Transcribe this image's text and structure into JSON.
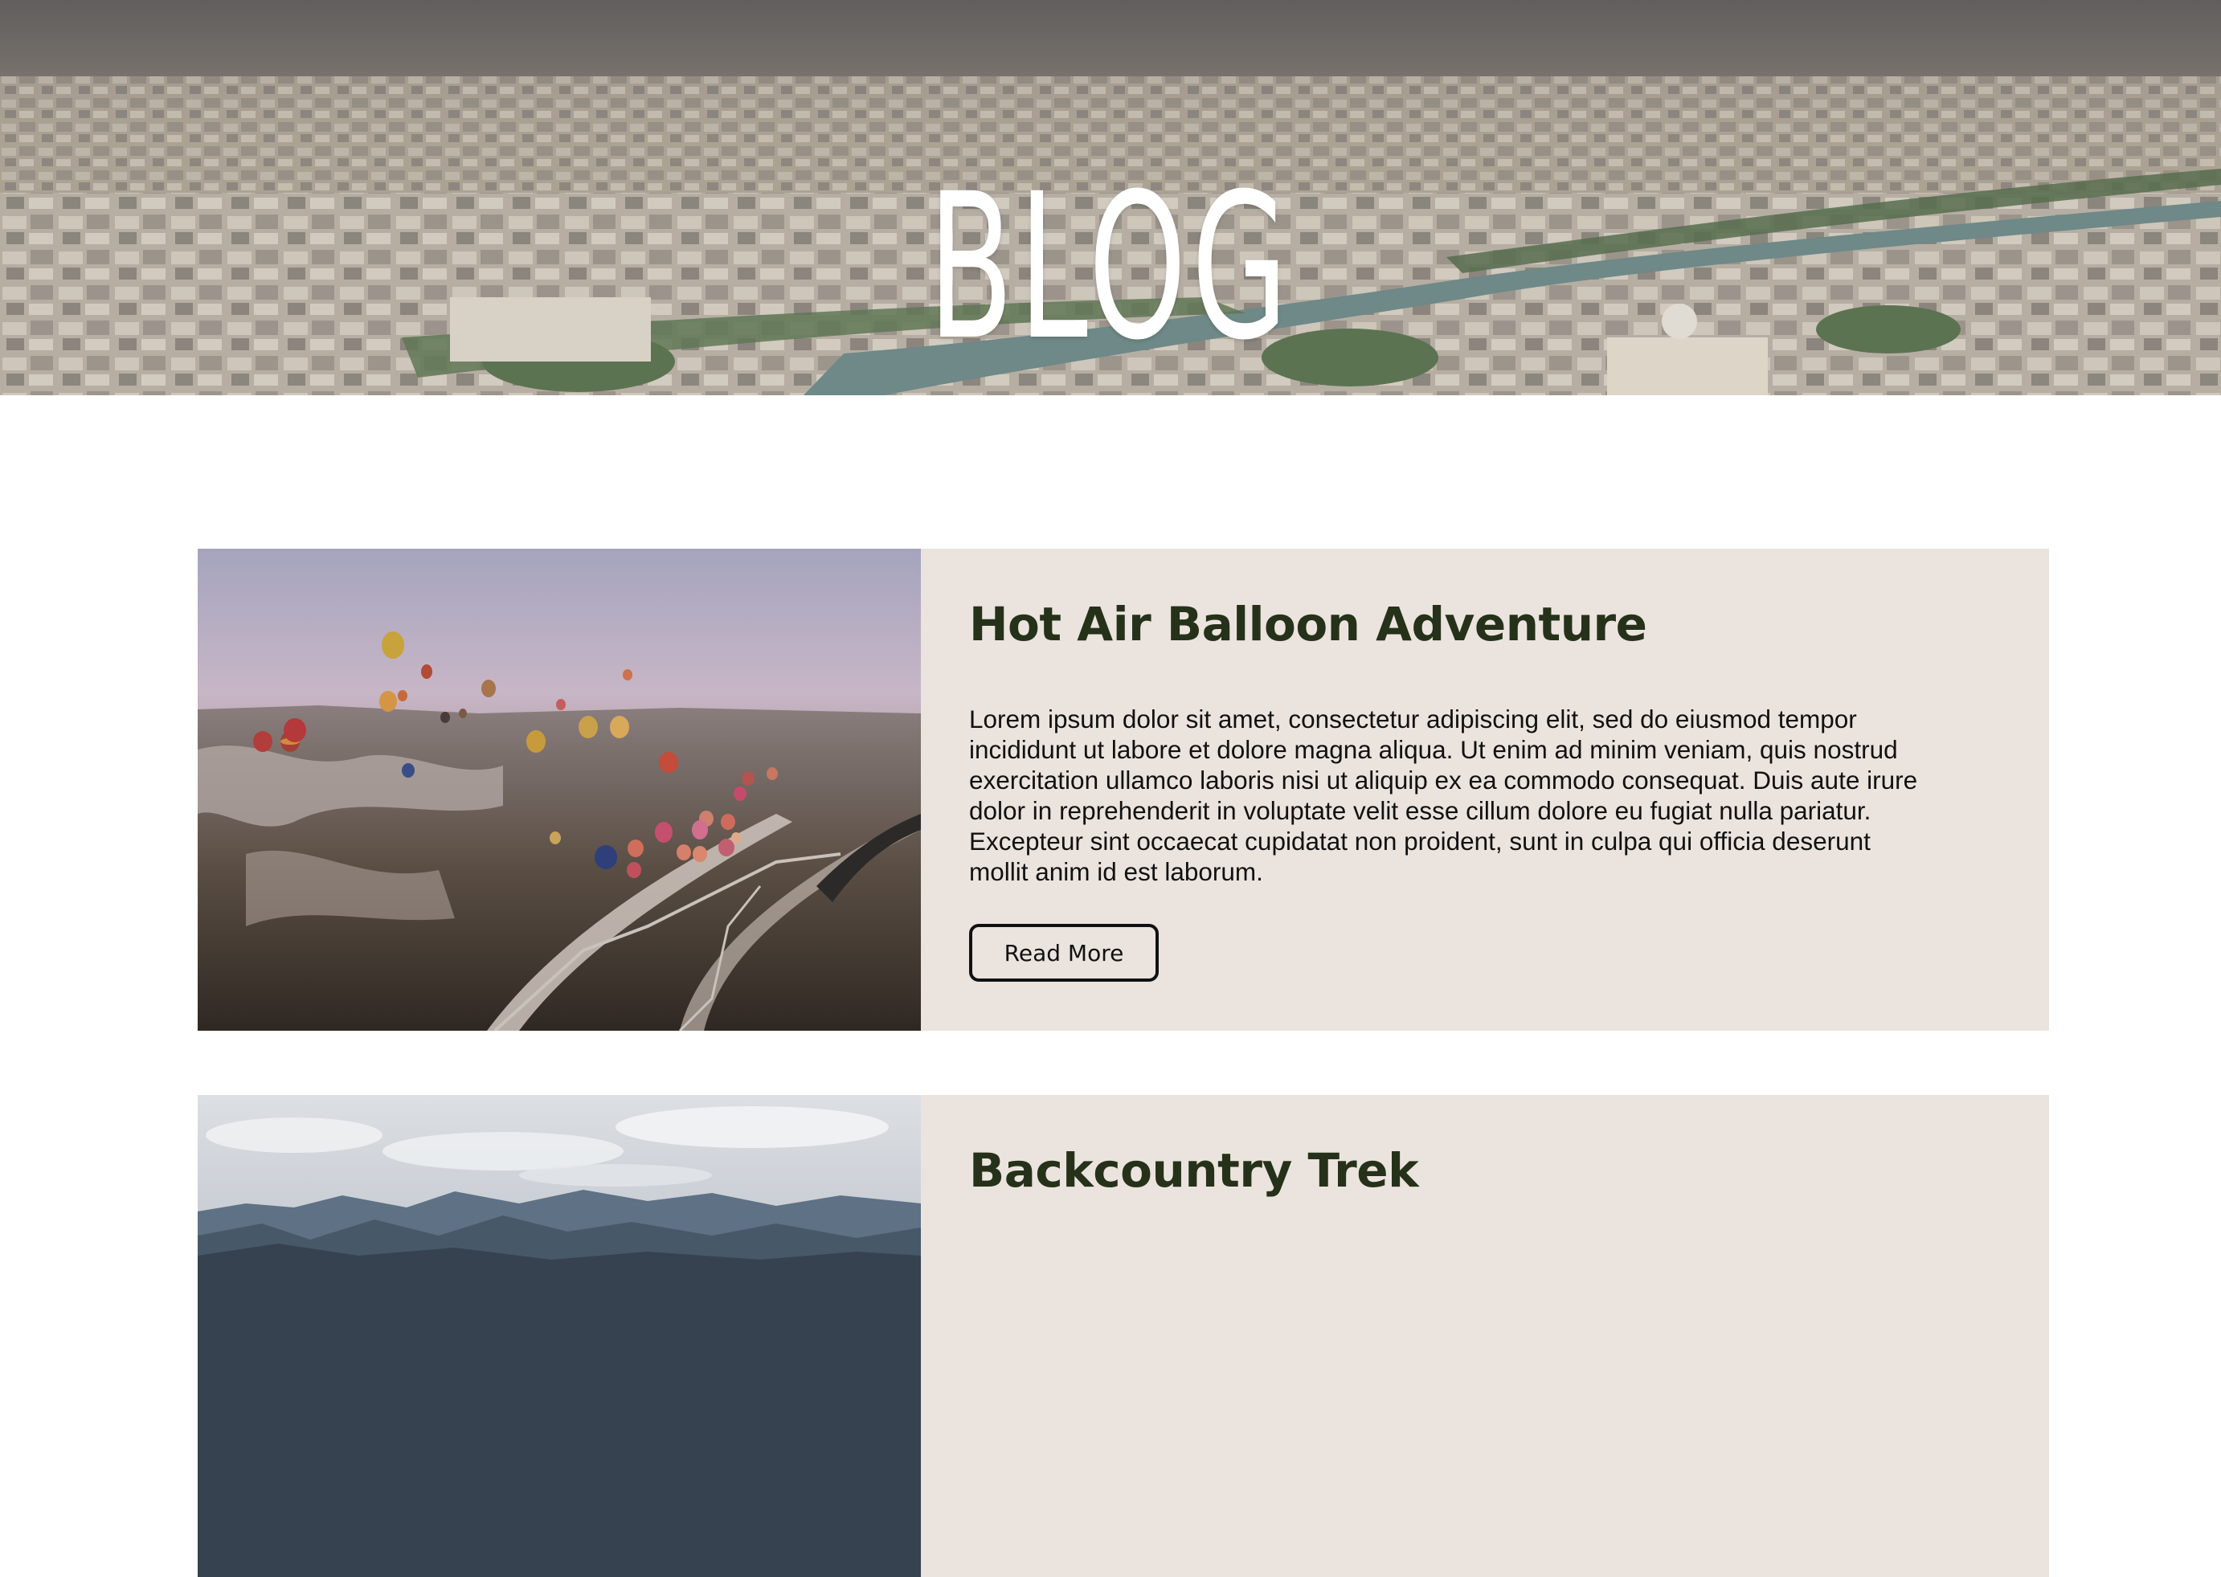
{
  "hero": {
    "title": "BLOG"
  },
  "posts": [
    {
      "title": "Hot Air Balloon Adventure",
      "excerpt": "Lorem ipsum dolor sit amet, consectetur adipiscing elit, sed do eiusmod tempor incididunt ut labore et dolore magna aliqua. Ut enim ad minim veniam, quis nostrud exercitation ullamco laboris nisi ut aliquip ex ea commodo consequat. Duis aute irure dolor in reprehenderit in voluptate velit esse cillum dolore eu fugiat nulla pariatur. Excepteur sint occaecat cupidatat non proident, sunt in culpa qui officia deserunt mollit anim id est laborum.",
      "button_label": "Read More"
    },
    {
      "title": "Backcountry Trek"
    }
  ],
  "colors": {
    "card_background": "#ebe4de",
    "title_color": "#263119",
    "hero_overlay": "#5e5c5a"
  }
}
